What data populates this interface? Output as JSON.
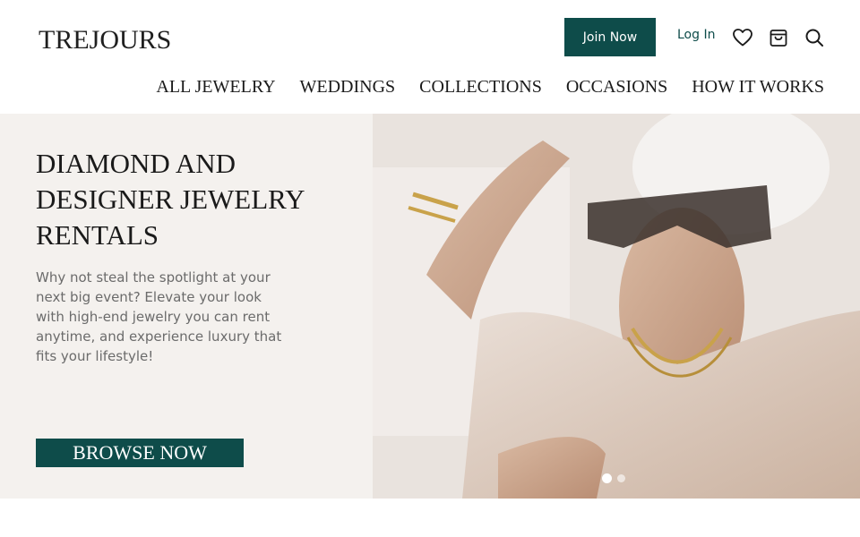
{
  "header": {
    "logo_text": "TREJOURS",
    "join_label": "Join Now",
    "login_label": "Log In",
    "icons": [
      "heart-icon",
      "bag-icon",
      "search-icon"
    ]
  },
  "nav": {
    "items": [
      {
        "label": "ALL JEWELRY"
      },
      {
        "label": "WEDDINGS"
      },
      {
        "label": "COLLECTIONS"
      },
      {
        "label": "OCCASIONS"
      },
      {
        "label": "HOW IT WORKS"
      }
    ]
  },
  "hero": {
    "title": "DIAMOND AND DESIGNER JEWELRY RENTALS",
    "description": "Why not steal the spotlight at your next big event? Elevate your look with high-end jewelry you can rent anytime, and experience luxury that fits your lifestyle!",
    "browse_label": "BROWSE NOW",
    "slides_total": 2,
    "active_slide": 1
  },
  "colors": {
    "brand": "#0e4c4a",
    "hero_bg": "#f4f1ee",
    "text_muted": "#6b6b6b"
  }
}
